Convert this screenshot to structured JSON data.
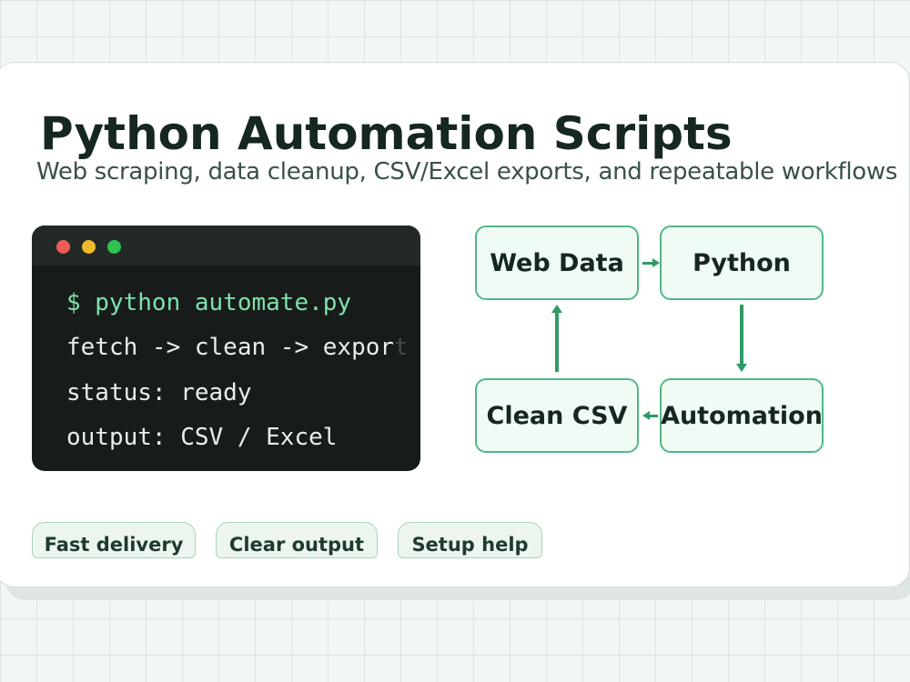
{
  "header": {
    "title": "Python Automation Scripts",
    "subtitle": "Web scraping, data cleanup, CSV/Excel exports, and repeatable workflows"
  },
  "terminal": {
    "lines": [
      "$ python automate.py",
      "fetch -> clean -> expor",
      "status: ready",
      "output: CSV / Excel"
    ],
    "faded_tail": "t"
  },
  "flow": {
    "nodes": [
      "Web Data",
      "Python",
      "Automation",
      "Clean CSV"
    ]
  },
  "badges": [
    "Fast delivery",
    "Clear output",
    "Setup help"
  ],
  "colors": {
    "accent": "#2f9a66",
    "node_border": "#4fb884",
    "terminal_bg": "#171c1a",
    "prompt": "#7fe1ac"
  }
}
